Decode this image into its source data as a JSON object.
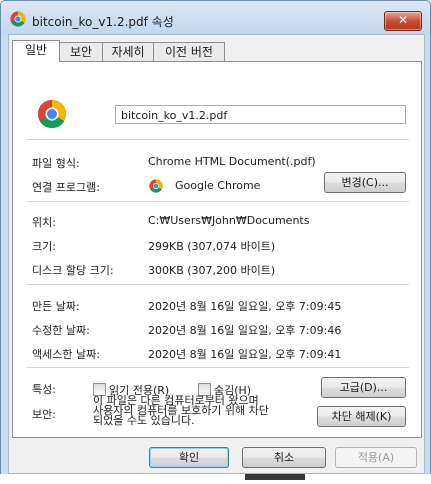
{
  "window": {
    "title": "bitcoin_ko_v1.2.pdf 속성",
    "close_label": "✕"
  },
  "tabs": [
    {
      "label": "일반"
    },
    {
      "label": "보안"
    },
    {
      "label": "자세히"
    },
    {
      "label": "이전 버전"
    }
  ],
  "general": {
    "file_name": "bitcoin_ko_v1.2.pdf",
    "file_type_label": "파일 형식:",
    "file_type_value": "Chrome HTML Document(.pdf)",
    "opens_with_label": "연결 프로그램:",
    "opens_with_value": "Google Chrome",
    "change_button": "변경(C)...",
    "location_label": "위치:",
    "location_value": "C:₩Users₩John₩Documents",
    "size_label": "크기:",
    "size_value": "299KB (307,074 바이트)",
    "size_on_disk_label": "디스크 할당 크기:",
    "size_on_disk_value": "300KB (307,200 바이트)",
    "created_label": "만든 날짜:",
    "created_value": "2020년 8월 16일 일요일, 오후 7:09:45",
    "modified_label": "수정한 날짜:",
    "modified_value": "2020년 8월 16일 일요일, 오후 7:09:46",
    "accessed_label": "액세스한 날짜:",
    "accessed_value": "2020년 8월 16일 일요일, 오후 7:09:41",
    "attributes_label": "특성:",
    "readonly_label": "읽기 전용(R)",
    "hidden_label": "숨김(H)",
    "advanced_button": "고급(D)...",
    "security_label": "보안:",
    "security_message": "이 파일은 다른 컴퓨터로부터 왔으며\n사용자의 컴퓨터를 보호하기 위해 차단\n되었을 수도 있습니다.",
    "unblock_button": "차단 해제(K)"
  },
  "footer": {
    "ok_button": "확인",
    "cancel_button": "취소",
    "apply_button": "적용(A)"
  },
  "colors": {
    "titlebar": "#c3d7ee",
    "close_button": "#c74a2f",
    "panel": "#ffffff"
  },
  "icons": {
    "app_icon": "chrome-icon",
    "close": "close-icon"
  }
}
